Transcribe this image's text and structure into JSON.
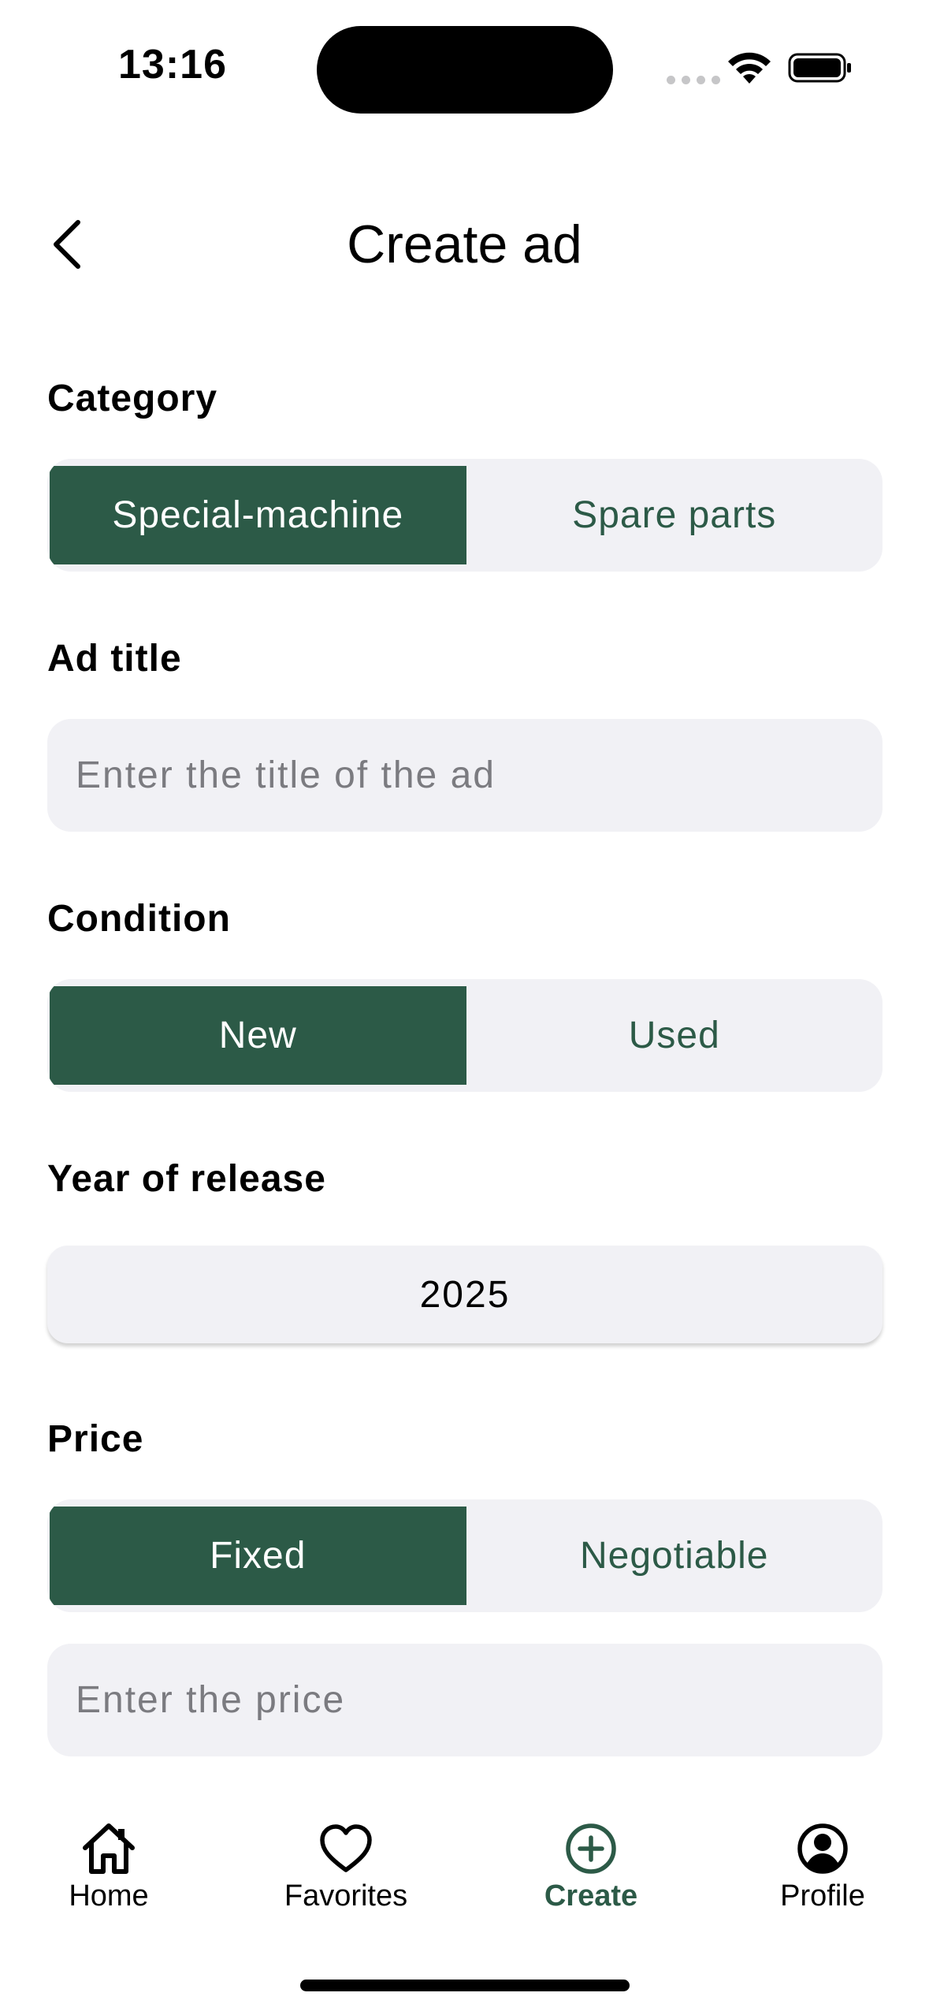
{
  "status_bar": {
    "time": "13:16"
  },
  "header": {
    "title": "Create ad"
  },
  "category": {
    "label": "Category",
    "options": [
      "Special-machine",
      "Spare parts"
    ],
    "selected": "Special-machine"
  },
  "ad_title": {
    "label": "Ad title",
    "placeholder": "Enter the title of the ad"
  },
  "condition": {
    "label": "Condition",
    "options": [
      "New",
      "Used"
    ],
    "selected": "New"
  },
  "year": {
    "label": "Year of release",
    "value": "2025"
  },
  "price": {
    "label": "Price",
    "options": [
      "Fixed",
      "Negotiable"
    ],
    "selected": "Fixed",
    "placeholder": "Enter the price"
  },
  "tabbar": {
    "items": [
      {
        "label": "Home",
        "icon": "home-icon"
      },
      {
        "label": "Favorites",
        "icon": "heart-icon"
      },
      {
        "label": "Create",
        "icon": "plus-circle-icon"
      },
      {
        "label": "Profile",
        "icon": "profile-icon"
      }
    ],
    "active": "Create"
  },
  "colors": {
    "accent": "#2c5a47",
    "field_bg": "#f1f1f5",
    "placeholder": "#7b7b80"
  }
}
